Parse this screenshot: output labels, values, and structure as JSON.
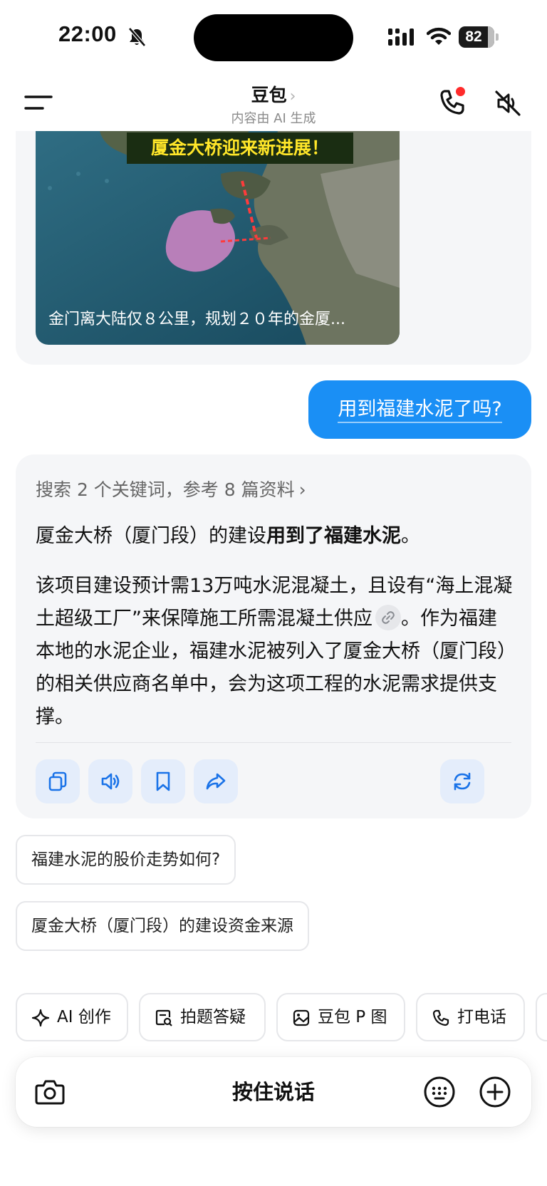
{
  "status_bar": {
    "time": "22:00",
    "battery": "82"
  },
  "header": {
    "title": "豆包",
    "subtitle": "内容由 AI 生成"
  },
  "video_card": {
    "banner": "厦金大桥迎来新进展！",
    "caption": "金门离大陆仅８公里，规划２０年的金厦..."
  },
  "user_message": "用到福建水泥了吗?",
  "answer": {
    "search_summary": "搜索 2 个关键词，参考 8 篇资料",
    "p1_pre": "厦金大桥（厦门段）的建设",
    "p1_bold": "用到了福建水泥",
    "p1_post": "。",
    "p2_part1": "该项目建设预计需13万吨水泥混凝土，且设有“海上混凝土超级工厂”来保障施工所需混凝土供应",
    "p2_part2": "。作为福建本地的水泥企业，福建水泥被列入了厦金大桥（厦门段）的相关供应商名单中，会为这项工程的水泥需求提供支撑。"
  },
  "suggestions": [
    "福建水泥的股价走势如何?",
    "厦金大桥（厦门段）的建设资金来源"
  ],
  "tools": [
    "AI 创作",
    "拍题答疑",
    "豆包 P 图",
    "打电话"
  ],
  "input_bar": {
    "hold_to_talk": "按住说话"
  },
  "colors": {
    "accent": "#1a8ff5",
    "card_bg": "#f5f6f8",
    "action_bg": "#e4edfb"
  }
}
